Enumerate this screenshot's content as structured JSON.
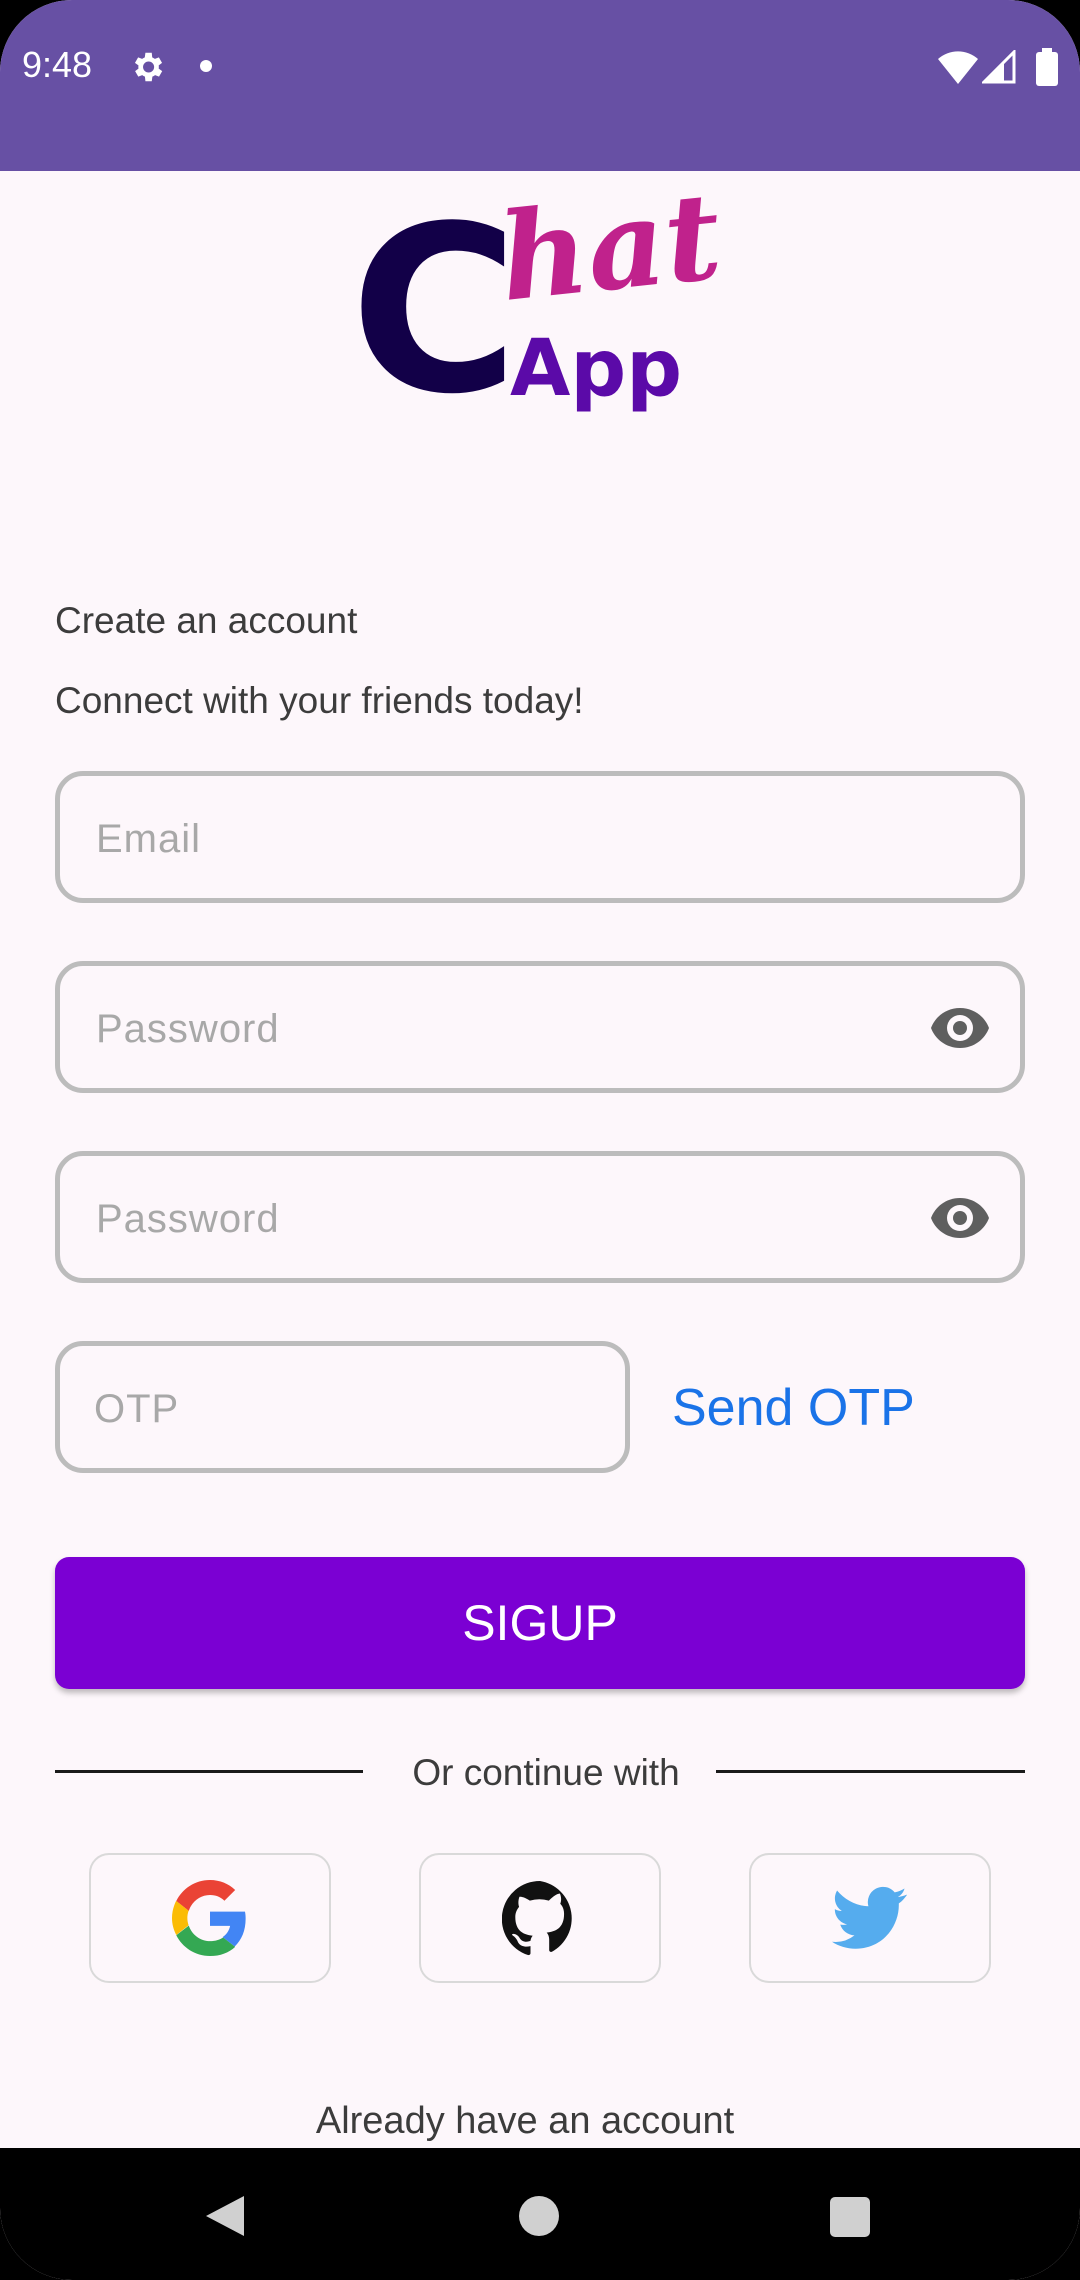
{
  "status_bar": {
    "time": "9:48",
    "icons": [
      "gear-icon",
      "notification-dot-icon",
      "wifi-icon",
      "signal-icon",
      "battery-icon"
    ],
    "background_color": "#6750a4"
  },
  "logo": {
    "letters_c": "C",
    "letters_hat": "hat",
    "letters_app": "App",
    "colors": {
      "c": "#120048",
      "hat": "#c0228c",
      "app": "#5b0aa8"
    }
  },
  "header": {
    "title": "Create an account",
    "subtitle": "Connect with your friends today!"
  },
  "form": {
    "email": {
      "placeholder": "Email",
      "value": ""
    },
    "password": {
      "placeholder": "Password",
      "value": ""
    },
    "confirm_password": {
      "placeholder": "Password",
      "value": ""
    },
    "otp": {
      "placeholder": "OTP",
      "value": ""
    },
    "send_otp_label": "Send OTP",
    "submit_label": "SIGUP"
  },
  "social": {
    "divider_label": "Or continue with",
    "providers": [
      "google-icon",
      "github-icon",
      "twitter-icon"
    ]
  },
  "footer": {
    "login_prompt": "Already have an account"
  },
  "colors": {
    "accent": "#7b00d3",
    "link": "#1a73e8",
    "background": "#fdf7fb"
  }
}
